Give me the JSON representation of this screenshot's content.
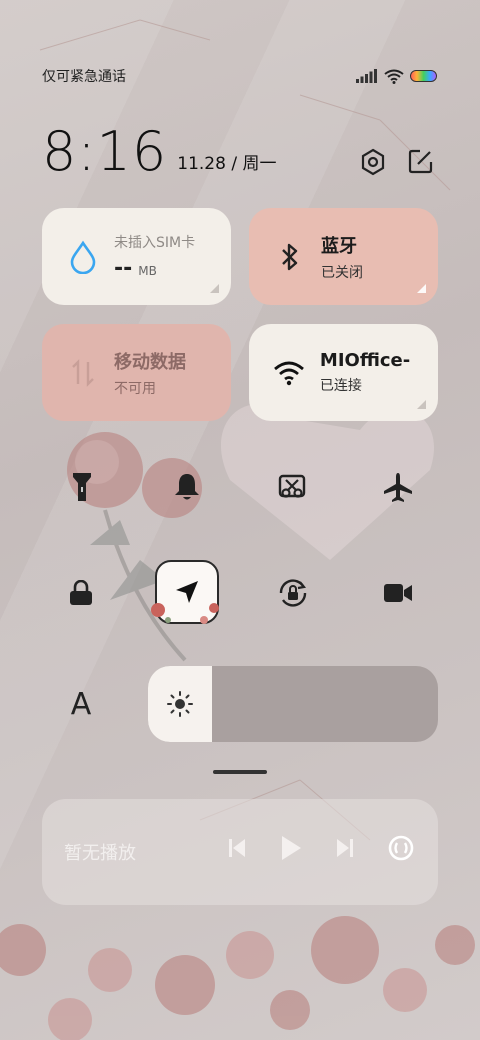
{
  "status_bar": {
    "carrier_text": "仅可紧急通话",
    "icons": [
      "signal-icon",
      "wifi-icon",
      "battery-icon"
    ],
    "battery_colors": [
      "#ff5a5a",
      "#ffb23a",
      "#43d05c",
      "#3aa8ff",
      "#b45cff"
    ]
  },
  "header": {
    "time": "8:16",
    "date": "11.28 / 周一",
    "actions": [
      "settings-icon",
      "edit-icon"
    ]
  },
  "tiles": {
    "data": {
      "line1": "未插入SIM卡",
      "value": "--",
      "unit": "MB",
      "icon": "droplet-icon",
      "accent": "#3aa6f0"
    },
    "bluetooth": {
      "title": "蓝牙",
      "subtitle": "已关闭",
      "icon": "bluetooth-icon"
    },
    "mobile": {
      "title": "移动数据",
      "subtitle": "不可用",
      "icon": "mobile-data-icon"
    },
    "wifi": {
      "title": "MIOffice-",
      "subtitle": "已连接",
      "icon": "wifi-icon"
    }
  },
  "toggles": {
    "row1": [
      "flashlight-icon",
      "bell-icon",
      "screenshot-icon",
      "airplane-icon"
    ],
    "row2": [
      "lock-icon",
      "location-icon",
      "rotation-lock-icon",
      "video-camera-icon"
    ]
  },
  "brightness": {
    "auto_label": "A",
    "level": 0.22,
    "icon": "sun-icon"
  },
  "media": {
    "status": "暂无播放",
    "controls": [
      "previous-icon",
      "play-icon",
      "next-icon",
      "cast-icon"
    ]
  }
}
